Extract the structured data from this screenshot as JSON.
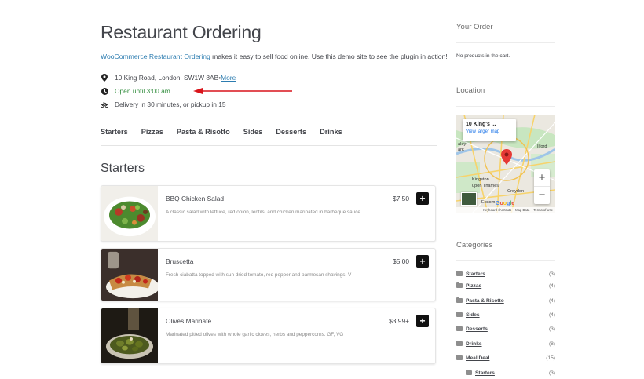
{
  "header": {
    "title": "Restaurant Ordering",
    "intro_link": "WooCommerce Restaurant Ordering",
    "intro_text": " makes it easy to sell food online. Use this demo site to see the plugin in action!"
  },
  "info": {
    "address": "10 King Road, London, SW1W 8AB",
    "address_sep": " • ",
    "more_link": "More",
    "open_status": "Open until 3:00 am",
    "delivery": "Delivery in 30 minutes, or pickup in 15",
    "open_color": "#2e8b3a",
    "arrow_color": "#d9141b"
  },
  "tabs": [
    "Starters",
    "Pizzas",
    "Pasta & Risotto",
    "Sides",
    "Desserts",
    "Drinks"
  ],
  "section_title": "Starters",
  "products": [
    {
      "name": "BBQ Chicken Salad",
      "description": "A classic salad with lettuce, red onion, lentils, and chicken marinated in barbeque sauce.",
      "price": "$7.50",
      "add_label": "+"
    },
    {
      "name": "Bruscetta",
      "description": "Fresh ciabatta topped with sun dried tomato, red pepper and parmesan shavings. V",
      "price": "$5.00",
      "add_label": "+"
    },
    {
      "name": "Olives Marinate",
      "description": "Marinated pitted olives with whole garlic cloves, herbs and peppercorns. GF, VG",
      "price": "$3.99+",
      "add_label": "+"
    }
  ],
  "sidebar": {
    "order_title": "Your Order",
    "empty_cart": "No products in the cart.",
    "location_title": "Location",
    "map": {
      "card_title": "10 King's ...",
      "card_link": "View larger map",
      "zoom_in": "+",
      "zoom_out": "−",
      "footer_shortcuts": "Keyboard shortcuts",
      "footer_data": "Map Data",
      "footer_terms": "Terms of Use",
      "google": "Google",
      "labels": {
        "ilford": "Ilford",
        "kingston": "Kingston",
        "upon_thames": "upon Thames",
        "croydon": "Croydon",
        "epsom": "Epsom",
        "ealey": "aley",
        "ark": "ark"
      },
      "pin_color": "#e53935"
    },
    "categories_title": "Categories",
    "categories": [
      {
        "name": "Starters",
        "count": "(3)"
      },
      {
        "name": "Pizzas",
        "count": "(4)"
      },
      {
        "name": "Pasta & Risotto",
        "count": "(4)"
      },
      {
        "name": "Sides",
        "count": "(4)"
      },
      {
        "name": "Desserts",
        "count": "(3)"
      },
      {
        "name": "Drinks",
        "count": "(8)"
      },
      {
        "name": "Meal Deal",
        "count": "(15)"
      },
      {
        "name": "Starters",
        "count": "(3)"
      }
    ]
  }
}
